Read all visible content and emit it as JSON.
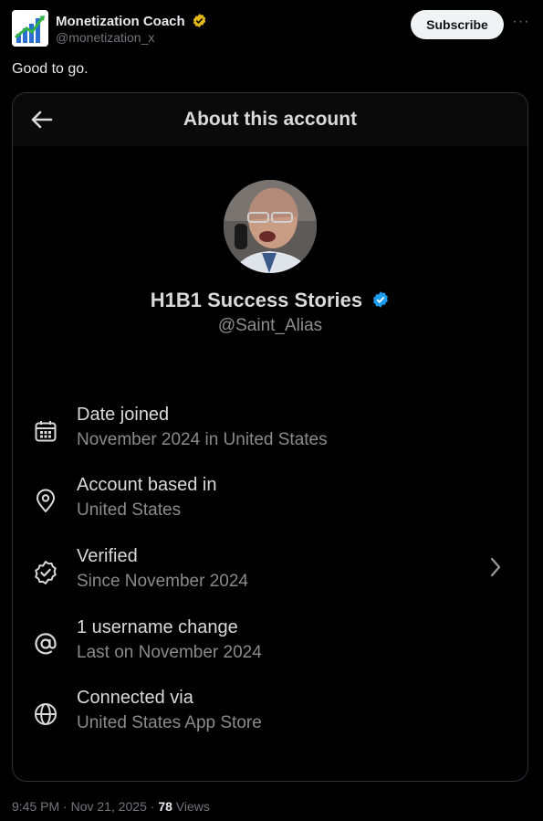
{
  "post": {
    "author_name": "Monetization Coach",
    "author_handle": "@monetization_x",
    "subscribe_label": "Subscribe",
    "more_label": "···",
    "text": "Good to go.",
    "time": "9:45 PM · Nov 21, 2025 · ",
    "views_count": "78",
    "views_label": " Views"
  },
  "card": {
    "title": "About this account",
    "name": "H1B1 Success Stories",
    "handle": "@Saint_Alias",
    "rows": [
      {
        "icon": "calendar-icon",
        "title": "Date joined",
        "subtitle": "November 2024 in United States"
      },
      {
        "icon": "location-pin-icon",
        "title": "Account based in",
        "subtitle": "United States"
      },
      {
        "icon": "verified-badge-icon",
        "title": "Verified",
        "subtitle": "Since November 2024"
      },
      {
        "icon": "at-sign-icon",
        "title": "1 username change",
        "subtitle": "Last on November 2024"
      },
      {
        "icon": "globe-icon",
        "title": "Connected via",
        "subtitle": "United States App Store"
      }
    ]
  },
  "colors": {
    "background": "#000000",
    "verified_gold": "#e2b719",
    "verified_blue": "#1d9bf0",
    "primary_text": "#e7e9ea",
    "secondary_text": "#71767b"
  }
}
